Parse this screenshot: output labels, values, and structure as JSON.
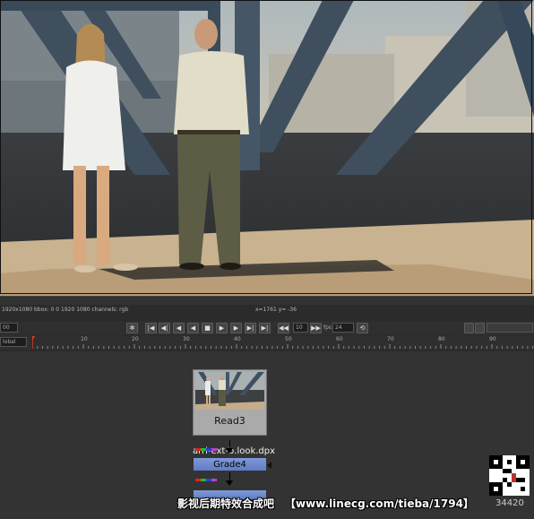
{
  "viewer": {
    "info_left": "1920x1080 bbox: 0 0 1920 1080 channels: rgb",
    "info_coords": "x=1761 y= -36"
  },
  "transport": {
    "current_frame": "00",
    "increment": "10",
    "fps_label": "fps",
    "fps_value": "24",
    "buttons": [
      "✻",
      "|◀",
      "◀|",
      "◀",
      "◀",
      "■",
      "▶",
      "▶",
      "▶|",
      "▶|",
      "◀◀",
      "▶▶",
      "⟲"
    ]
  },
  "timeline": {
    "mode": "lobal",
    "ticks": [
      "10",
      "20",
      "30",
      "40",
      "50",
      "60",
      "70",
      "80",
      "90"
    ]
  },
  "nodes": {
    "read": {
      "name": "Read3",
      "file": "arri-ext-b.look.dpx"
    },
    "grade": {
      "name": "Grade4"
    }
  },
  "colors": {
    "read_node": "#aaaaaa",
    "grade_node": "#7f9ad8",
    "chip_red": "#e02020",
    "chip_green": "#20c020",
    "chip_blue": "#2040e0",
    "chip_purple": "#c040c0"
  },
  "watermark": {
    "chinese": "影视后期特效合成吧",
    "url": "【www.linecg.com/tieba/1794】",
    "id": "34420"
  }
}
